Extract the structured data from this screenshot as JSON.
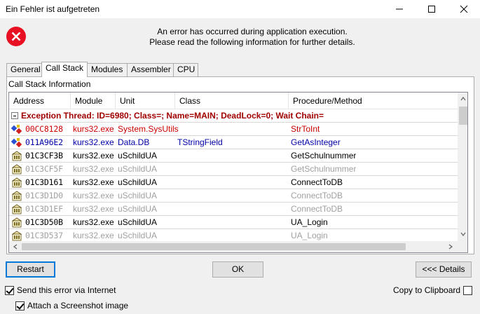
{
  "window": {
    "title": "Ein Fehler ist aufgetreten"
  },
  "message": {
    "line1": "An error has occurred during application execution.",
    "line2": "Please read the following information for further details."
  },
  "tabs": [
    {
      "label": "General",
      "active": false
    },
    {
      "label": "Call Stack",
      "active": true
    },
    {
      "label": "Modules",
      "active": false
    },
    {
      "label": "Assembler",
      "active": false
    },
    {
      "label": "CPU",
      "active": false
    }
  ],
  "section_label": "Call Stack Information",
  "columns": [
    "Address",
    "Module",
    "Unit",
    "Class",
    "Procedure/Method"
  ],
  "group_row": "Exception Thread: ID=6980; Class=; Name=MAIN; DeadLock=0; Wait Chain=",
  "rows": [
    {
      "address": "00CC8128",
      "module": "kurs32.exe",
      "unit": "System.SysUtils",
      "class": "",
      "procedure": "StrToInt",
      "style": "red",
      "icon": "exception-icon"
    },
    {
      "address": "011A96E2",
      "module": "kurs32.exe",
      "unit": "Data.DB",
      "class": "TStringField",
      "procedure": "GetAsInteger",
      "style": "blue",
      "icon": "method-icon"
    },
    {
      "address": "01C3CF3B",
      "module": "kurs32.exe",
      "unit": "uSchildUA",
      "class": "",
      "procedure": "GetSchulnummer",
      "style": "normal",
      "icon": "unit-icon"
    },
    {
      "address": "01C3CF5F",
      "module": "kurs32.exe",
      "unit": "uSchildUA",
      "class": "",
      "procedure": "GetSchulnummer",
      "style": "gray",
      "icon": "unit-icon"
    },
    {
      "address": "01C3D161",
      "module": "kurs32.exe",
      "unit": "uSchildUA",
      "class": "",
      "procedure": "ConnectToDB",
      "style": "normal",
      "icon": "unit-icon"
    },
    {
      "address": "01C3D1D0",
      "module": "kurs32.exe",
      "unit": "uSchildUA",
      "class": "",
      "procedure": "ConnectToDB",
      "style": "gray",
      "icon": "unit-icon"
    },
    {
      "address": "01C3D1EF",
      "module": "kurs32.exe",
      "unit": "uSchildUA",
      "class": "",
      "procedure": "ConnectToDB",
      "style": "gray",
      "icon": "unit-icon"
    },
    {
      "address": "01C3D50B",
      "module": "kurs32.exe",
      "unit": "uSchildUA",
      "class": "",
      "procedure": "UA_Login",
      "style": "normal",
      "icon": "unit-icon"
    },
    {
      "address": "01C3D537",
      "module": "kurs32.exe",
      "unit": "uSchildUA",
      "class": "",
      "procedure": "UA_Login",
      "style": "gray",
      "icon": "unit-icon"
    }
  ],
  "buttons": {
    "restart": "Restart",
    "ok": "OK",
    "details": "<<< Details"
  },
  "checkboxes": {
    "send": {
      "label": "Send this error via Internet",
      "checked": true
    },
    "screenshot": {
      "label": "Attach a Screenshot image",
      "checked": true
    },
    "clipboard": {
      "label": "Copy to Clipboard",
      "checked": false
    }
  },
  "colors": {
    "accent": "#0078d7",
    "error_red": "#e81123",
    "exception_text": "#a00000",
    "gray_text": "#a0a0a0",
    "blue_text": "#0000a8"
  }
}
